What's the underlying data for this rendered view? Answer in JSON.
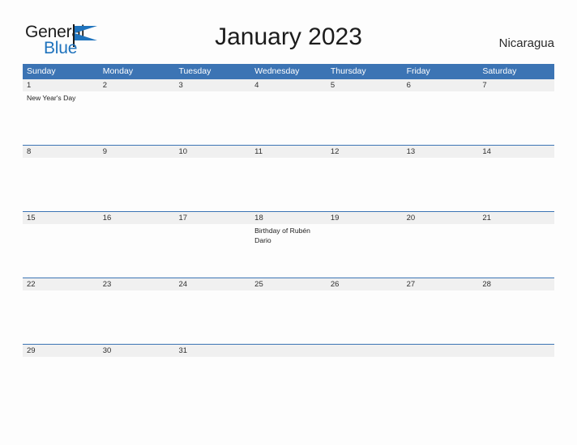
{
  "brand": {
    "name_part1": "General",
    "name_part2": "Blue",
    "flag_icon": "flag-triangle-icon",
    "accent_color": "#1f73bd"
  },
  "header": {
    "title": "January 2023",
    "country": "Nicaragua"
  },
  "colors": {
    "header_blue": "#3c74b4",
    "row_band_gray": "#f0f0f0",
    "page_background": "#fdfdfd",
    "text_dark": "#2e2e2e"
  },
  "calendar": {
    "month": "January",
    "year": "2023",
    "weekdays": [
      "Sunday",
      "Monday",
      "Tuesday",
      "Wednesday",
      "Thursday",
      "Friday",
      "Saturday"
    ],
    "weeks": [
      [
        {
          "day": "1",
          "event": "New Year's Day"
        },
        {
          "day": "2",
          "event": ""
        },
        {
          "day": "3",
          "event": ""
        },
        {
          "day": "4",
          "event": ""
        },
        {
          "day": "5",
          "event": ""
        },
        {
          "day": "6",
          "event": ""
        },
        {
          "day": "7",
          "event": ""
        }
      ],
      [
        {
          "day": "8",
          "event": ""
        },
        {
          "day": "9",
          "event": ""
        },
        {
          "day": "10",
          "event": ""
        },
        {
          "day": "11",
          "event": ""
        },
        {
          "day": "12",
          "event": ""
        },
        {
          "day": "13",
          "event": ""
        },
        {
          "day": "14",
          "event": ""
        }
      ],
      [
        {
          "day": "15",
          "event": ""
        },
        {
          "day": "16",
          "event": ""
        },
        {
          "day": "17",
          "event": ""
        },
        {
          "day": "18",
          "event": "Birthday of Rubén Dario"
        },
        {
          "day": "19",
          "event": ""
        },
        {
          "day": "20",
          "event": ""
        },
        {
          "day": "21",
          "event": ""
        }
      ],
      [
        {
          "day": "22",
          "event": ""
        },
        {
          "day": "23",
          "event": ""
        },
        {
          "day": "24",
          "event": ""
        },
        {
          "day": "25",
          "event": ""
        },
        {
          "day": "26",
          "event": ""
        },
        {
          "day": "27",
          "event": ""
        },
        {
          "day": "28",
          "event": ""
        }
      ],
      [
        {
          "day": "29",
          "event": ""
        },
        {
          "day": "30",
          "event": ""
        },
        {
          "day": "31",
          "event": ""
        },
        {
          "day": "",
          "event": ""
        },
        {
          "day": "",
          "event": ""
        },
        {
          "day": "",
          "event": ""
        },
        {
          "day": "",
          "event": ""
        }
      ]
    ]
  }
}
